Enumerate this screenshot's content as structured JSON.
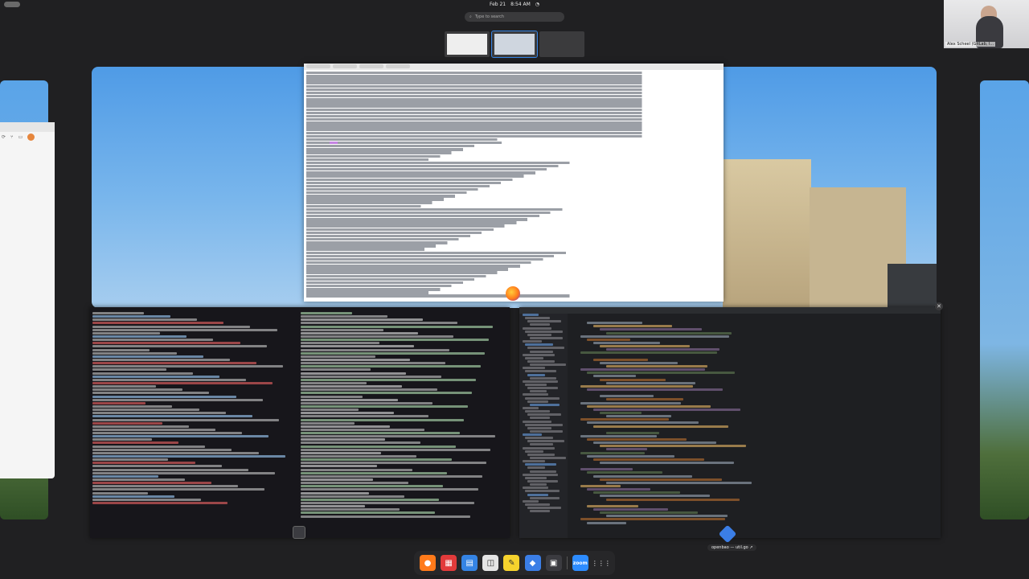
{
  "topbar": {
    "date": "Feb 21",
    "time": "8:54 AM",
    "indicator": "◔"
  },
  "search": {
    "placeholder": "Type to search"
  },
  "webcam": {
    "name": "Alex Scheel (GitLab, I..."
  },
  "workspaces": [
    {
      "label": "Workspace 1",
      "active": false
    },
    {
      "label": "Workspace 2",
      "active": true
    },
    {
      "label": "Workspace 3",
      "active": false
    }
  ],
  "tooltip": {
    "text": "openbao — util.go ↗"
  },
  "dock": {
    "items": [
      {
        "name": "firefox",
        "icon": "firefox-icon",
        "color": "#ff7a1a"
      },
      {
        "name": "calendar",
        "icon": "calendar-icon",
        "color": "#e23b3b"
      },
      {
        "name": "document-viewer",
        "icon": "document-icon",
        "color": "#3584e4"
      },
      {
        "name": "software",
        "icon": "shopping-bag-icon",
        "color": "#e5e5e5"
      },
      {
        "name": "text-editor",
        "icon": "text-editor-icon",
        "color": "#f6d32d"
      },
      {
        "name": "goland",
        "icon": "ide-icon",
        "color": "#3b7ee6"
      },
      {
        "name": "terminal",
        "icon": "terminal-icon",
        "color": "#3b3b40"
      },
      {
        "name": "zoom",
        "icon": "zoom-icon",
        "color": "#2d8cff",
        "label": "zoom"
      },
      {
        "name": "show-apps",
        "icon": "app-grid-icon",
        "color": "#ffffff"
      }
    ]
  }
}
